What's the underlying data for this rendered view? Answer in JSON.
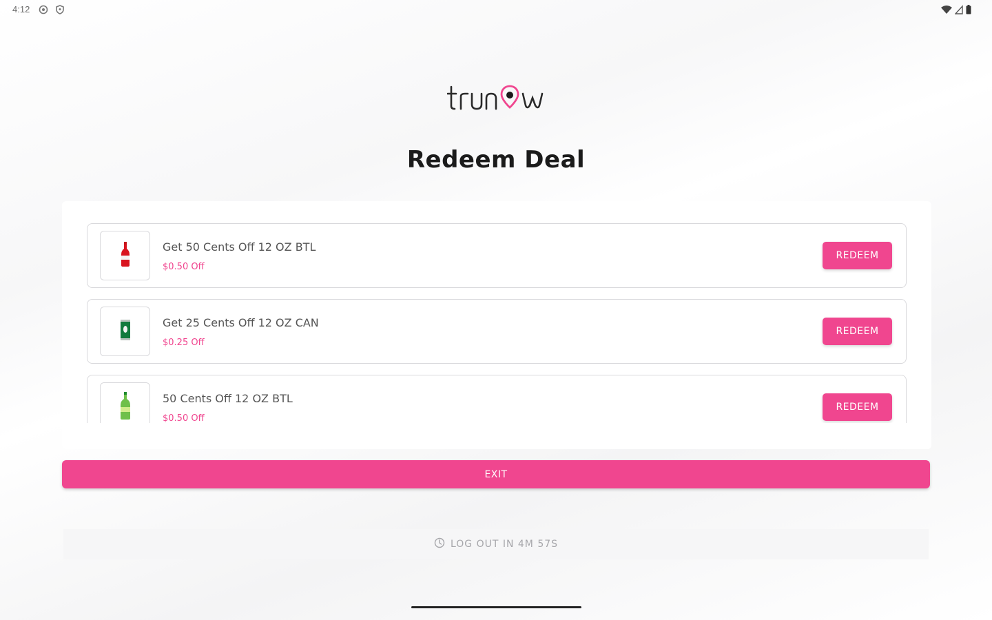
{
  "status_bar": {
    "time": "4:12",
    "left_icons": [
      "settings-icon",
      "shield-icon"
    ],
    "right_icons": [
      "wifi-icon",
      "signal-icon",
      "battery-icon"
    ]
  },
  "brand": {
    "logo_text": "trunow",
    "accent_color": "#f0468f"
  },
  "page": {
    "title": "Redeem Deal"
  },
  "deals": [
    {
      "title": "Get 50 Cents Off 12 OZ BTL",
      "discount": "$0.50 Off",
      "button_label": "REDEEM",
      "product_icon": "red-soda-bottle-icon"
    },
    {
      "title": "Get 25 Cents Off 12 OZ CAN",
      "discount": "$0.25 Off",
      "button_label": "REDEEM",
      "product_icon": "green-soda-can-icon"
    },
    {
      "title": "50 Cents Off 12 OZ BTL",
      "discount": "$0.50 Off",
      "button_label": "REDEEM",
      "product_icon": "green-soda-bottle-icon"
    }
  ],
  "actions": {
    "exit_label": "EXIT"
  },
  "session": {
    "logout_text": "LOG OUT IN 4M 57S",
    "icon": "clock-icon"
  }
}
